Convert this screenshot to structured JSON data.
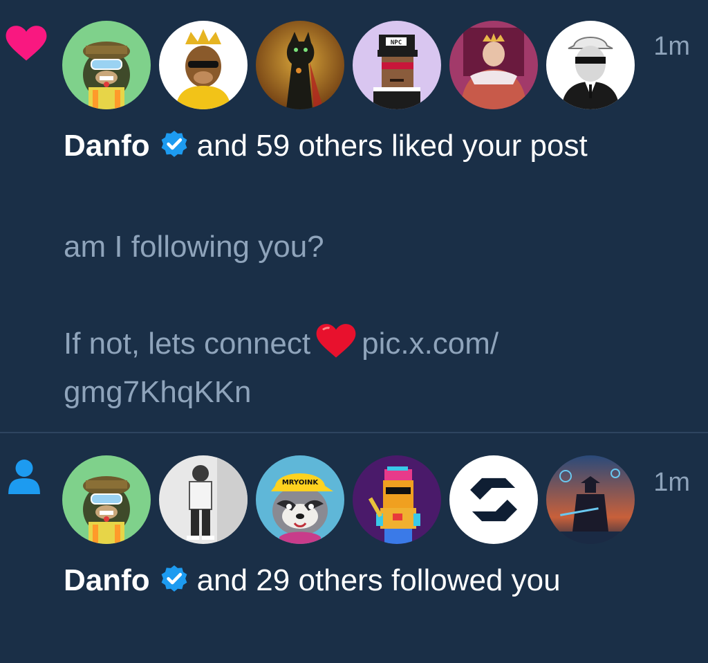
{
  "notifications": [
    {
      "type": "like",
      "time": "1m",
      "name": "Danfo",
      "action_text": "and 59 others liked your post",
      "post": {
        "line1": "am I following you?",
        "line2_text": "If not, lets connect",
        "line2_link_part1": "pic.x.com/",
        "line3_link_part2": "gmg7KhqKKn"
      },
      "avatar_labels": [
        "NPC"
      ]
    },
    {
      "type": "follow",
      "time": "1m",
      "name": "Danfo",
      "action_text": "and 29 others followed you",
      "avatar_labels": [
        "MRYOINK"
      ]
    }
  ],
  "colors": {
    "background": "#1a2f47",
    "secondary_text": "#8fa4bb",
    "like_icon": "#f91880",
    "follow_icon": "#1d9bf0",
    "verified_badge": "#1d9bf0",
    "divider": "#2e4560"
  },
  "icons": {
    "like": "heart-icon",
    "follow": "person-icon",
    "verified": "verified-badge-icon"
  }
}
